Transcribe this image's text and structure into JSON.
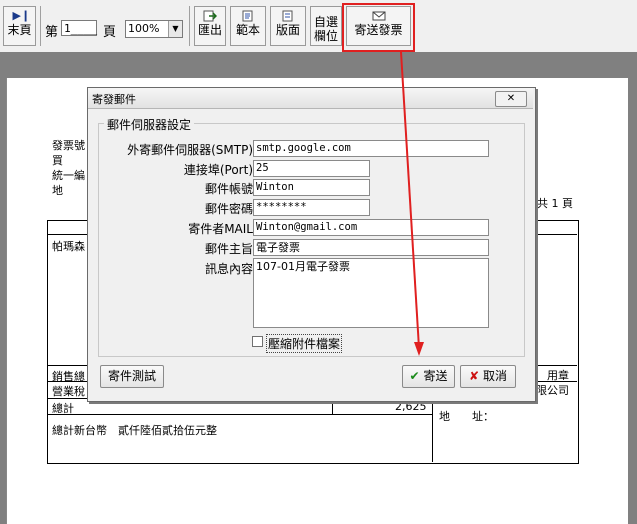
{
  "toolbar": {
    "last_page": {
      "icon": "last-page-icon",
      "label": "末頁"
    },
    "page_prefix": "第",
    "page_value": "1____",
    "page_suffix": "頁",
    "zoom": "100%",
    "export": {
      "icon": "export-icon",
      "label": "匯出"
    },
    "template": {
      "icon": "template-icon",
      "label": "範本"
    },
    "layout": {
      "icon": "layout-icon",
      "label": "版面"
    },
    "custom_fields": {
      "label_line1": "自選",
      "label_line2": "欄位"
    },
    "send_invoice": {
      "icon": "mail-icon",
      "label": "寄送發票"
    }
  },
  "report": {
    "left_labels": [
      "發票號",
      "買",
      "統一編",
      "地"
    ],
    "pages_total": "共 1 頁",
    "company_name": "帕瑪森",
    "sales_total_label": "銷售總",
    "tax_label": "營業稅",
    "stamp_label": "用章",
    "company_suffix": "有限公司",
    "total_label": "總計",
    "total_value": "2,625",
    "address_label": "地　　址：",
    "total_chinese": "總計新台幣　貳仟陸佰貳拾伍元整"
  },
  "dialog": {
    "title": "寄發郵件",
    "close_icon": "close-icon",
    "group_title": "郵件伺服器設定",
    "fields": [
      {
        "label": "外寄郵件伺服器(SMTP)",
        "value": "smtp.google.com"
      },
      {
        "label": "連接埠(Port)",
        "value": "25"
      },
      {
        "label": "郵件帳號",
        "value": "Winton"
      },
      {
        "label": "郵件密碼",
        "value": "********"
      },
      {
        "label": "寄件者MAIL",
        "value": "Winton@gmail.com"
      },
      {
        "label": "郵件主旨",
        "value": "電子發票"
      },
      {
        "label": "訊息內容",
        "value": "107-01月電子發票"
      }
    ],
    "compress_label": "壓縮附件檔案",
    "compress_checked": false,
    "test_button": "寄件測試",
    "send_button": "寄送",
    "cancel_button": "取消"
  },
  "colors": {
    "highlight": "#e02020",
    "send_check": "#1a8a1a",
    "cancel_x": "#cc1111"
  }
}
